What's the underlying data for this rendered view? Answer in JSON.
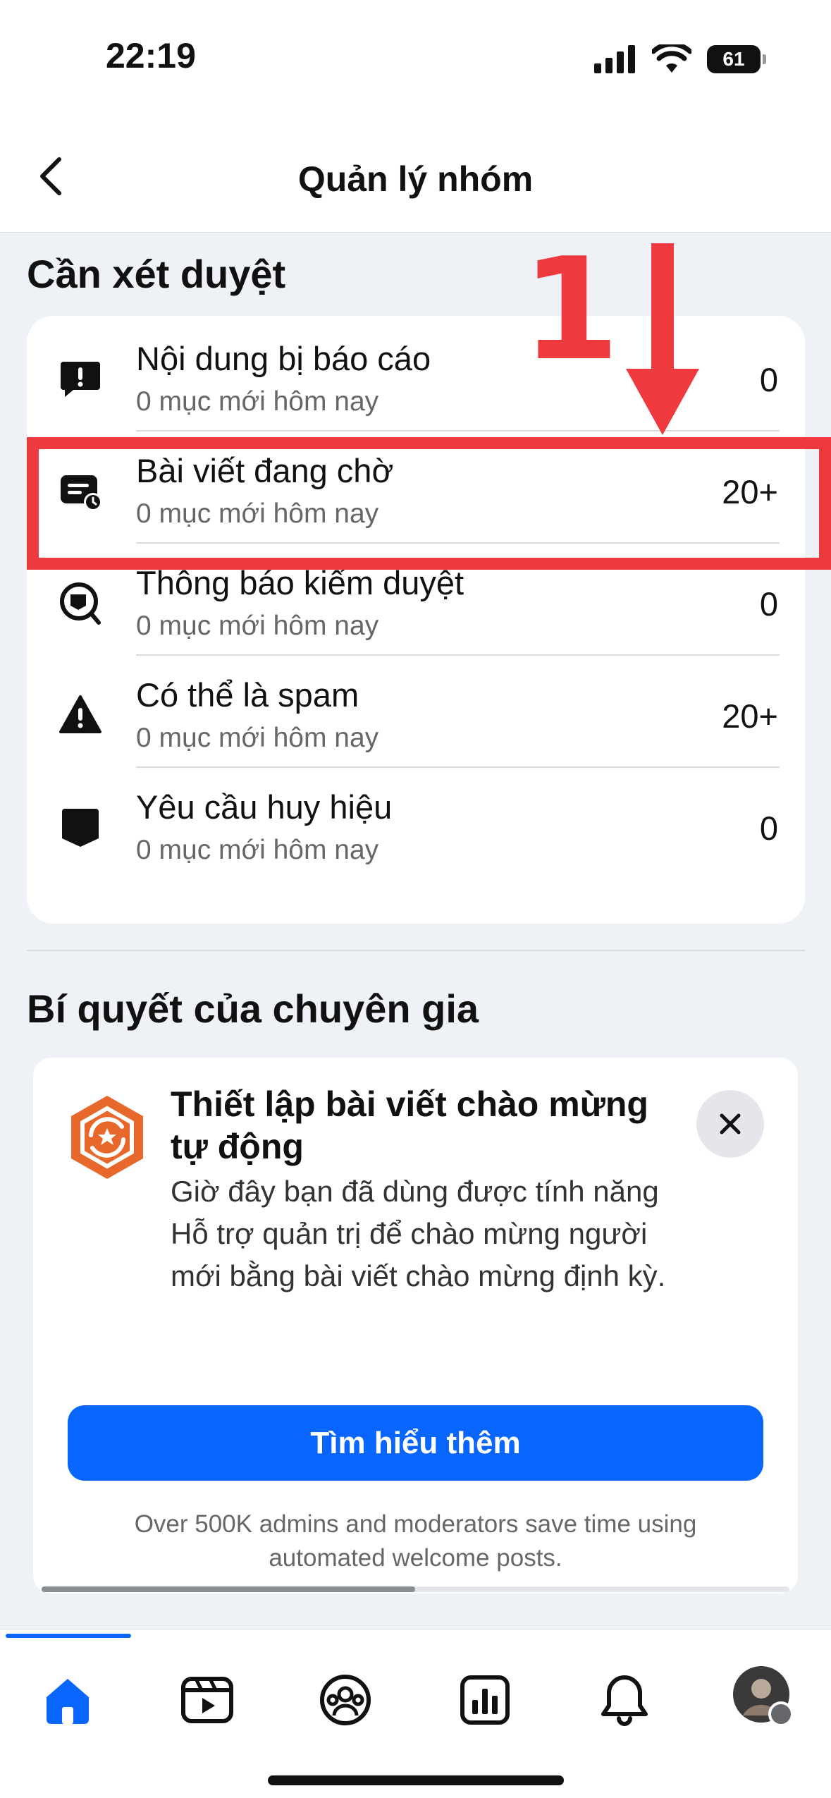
{
  "status_bar": {
    "time": "22:19",
    "battery": "61"
  },
  "header": {
    "title": "Quản lý nhóm"
  },
  "review": {
    "section_title": "Cần xét duyệt",
    "items": [
      {
        "title": "Nội dung bị báo cáo",
        "subtitle": "0 mục mới hôm nay",
        "count": "0",
        "icon": "report-icon"
      },
      {
        "title": "Bài viết đang chờ",
        "subtitle": "0 mục mới hôm nay",
        "count": "20+",
        "icon": "pending-post-icon"
      },
      {
        "title": "Thông báo kiểm duyệt",
        "subtitle": "0 mục mới hôm nay",
        "count": "0",
        "icon": "moderation-alert-icon"
      },
      {
        "title": "Có thể là spam",
        "subtitle": "0 mục mới hôm nay",
        "count": "20+",
        "icon": "spam-warning-icon"
      },
      {
        "title": "Yêu cầu huy hiệu",
        "subtitle": "0 mục mới hôm nay",
        "count": "0",
        "icon": "badge-icon"
      }
    ]
  },
  "tips": {
    "section_title": "Bí quyết của chuyên gia",
    "card": {
      "title": "Thiết lập bài viết chào mừng tự động",
      "body": "Giờ đây bạn đã dùng được tính năng Hỗ trợ quản trị để chào mừng người mới bằng bài viết chào mừng định kỳ.",
      "button_label": "Tìm hiểu thêm",
      "footer": "Over 500K admins and moderators save time using automated welcome posts."
    }
  },
  "annotation": {
    "number": "1"
  },
  "tab_bar": {
    "tabs": [
      "home-icon",
      "video-icon",
      "groups-icon",
      "insights-icon",
      "notifications-icon",
      "profile-avatar"
    ],
    "active": "home-icon"
  },
  "colors": {
    "accent": "#0866ff",
    "annotation": "#ee3a3f",
    "background": "#eef1f5"
  }
}
